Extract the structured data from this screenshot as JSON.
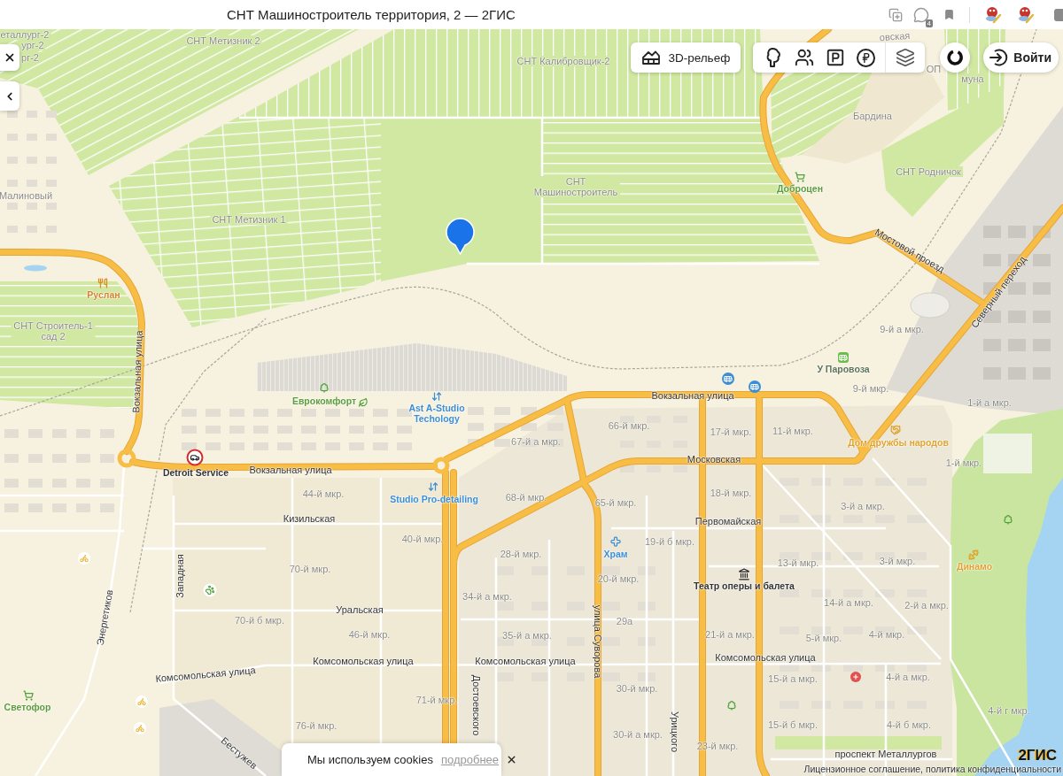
{
  "browser": {
    "title": "СНТ Машиностроитель территория, 2 — 2ГИС",
    "badge": "4"
  },
  "map": {
    "areas": [
      "еталлург-2",
      "ург-2",
      "рг-2",
      "СНТ Метизник 2",
      "овская",
      "СНТ Калибровщик-2",
      "ОП",
      "муна",
      "Бардина",
      "СНТ Родничок",
      "Малиновый",
      "СНТ Машиностроитель",
      "СНТ Метизник 1",
      "СНТ Строитель-1 сад 2",
      "9-й а мкр.",
      "9-й мкр.",
      "1-й а мкр.",
      "66-й мкр.",
      "17-й мкр.",
      "11-й мкр.",
      "67-й а мкр.",
      "1-й мкр.",
      "44-й мкр.",
      "68-й мкр.",
      "65-й мкр.",
      "18-й мкр.",
      "3-й а мкр.",
      "40-й мкр.",
      "19-й б мкр.",
      "28-й мкр.",
      "13-й мкр.",
      "3-й мкр.",
      "70-й мкр.",
      "20-й мкр.",
      "34-й а мкр.",
      "14-й а мкр.",
      "2-й а мкр.",
      "70-й б мкр.",
      "29а",
      "46-й мкр.",
      "35-й а мкр.",
      "21-й а мкр.",
      "5-й мкр.",
      "4-й мкр.",
      "15-й а мкр.",
      "4-й а мкр.",
      "30-й мкр.",
      "71-й мкр.",
      "4-й г мкр.",
      "76-й мкр.",
      "15-й б мкр.",
      "4-й б мкр.",
      "30-й а мкр.",
      "23-й мкр."
    ],
    "streets": [
      "Мостовой проезд",
      "Северный переход",
      "Вокзальная улица",
      "Вокзальная улица",
      "Московская",
      "Вокзальная улица",
      "Кизильская",
      "Первомайская",
      "Западная",
      "Уральская",
      "Энергетиков",
      "улица Суворова",
      "Комсомольская улица",
      "Комсомольская улица",
      "Комсомольская улица",
      "Комсомольская улица",
      "Достоевского",
      "Урицкого",
      "проспект Металлургов",
      "Бестужев"
    ],
    "places": [
      {
        "name": "Доброцен",
        "kind": "shop",
        "color": "#5c9e3c"
      },
      {
        "name": "Руслан",
        "kind": "food",
        "color": "#d9822b"
      },
      {
        "name": "У Паровоза",
        "kind": "transport",
        "color": "#5e7459"
      },
      {
        "name": "Еврокомфорт",
        "kind": "garden",
        "color": "#5c9e3c"
      },
      {
        "name": "Ast A-Studio Techology",
        "kind": "service",
        "color": "#3b8ed4"
      },
      {
        "name": "Дом дружбы народов",
        "kind": "community",
        "color": "#e0a22d"
      },
      {
        "name": "Detroit Service",
        "kind": "car",
        "color": "#333333"
      },
      {
        "name": "Studio Pro-detailing",
        "kind": "service",
        "color": "#3b8ed4"
      },
      {
        "name": "Храм",
        "kind": "church",
        "color": "#3b8ed4"
      },
      {
        "name": "Динамо",
        "kind": "sport",
        "color": "#e0a22d"
      },
      {
        "name": "Театр оперы и балета",
        "kind": "theatre",
        "color": "#333333"
      },
      {
        "name": "Светофор",
        "kind": "shop",
        "color": "#5c9e3c"
      }
    ]
  },
  "controls": {
    "relief_button": "3D-рельеф",
    "login_button": "Войти"
  },
  "cookie_banner": {
    "text": "Мы используем cookies",
    "link": "подробнее"
  },
  "footer": {
    "logo": "2ГИС",
    "legal": "Лицензионное соглашение, политика конфиденциальности"
  }
}
